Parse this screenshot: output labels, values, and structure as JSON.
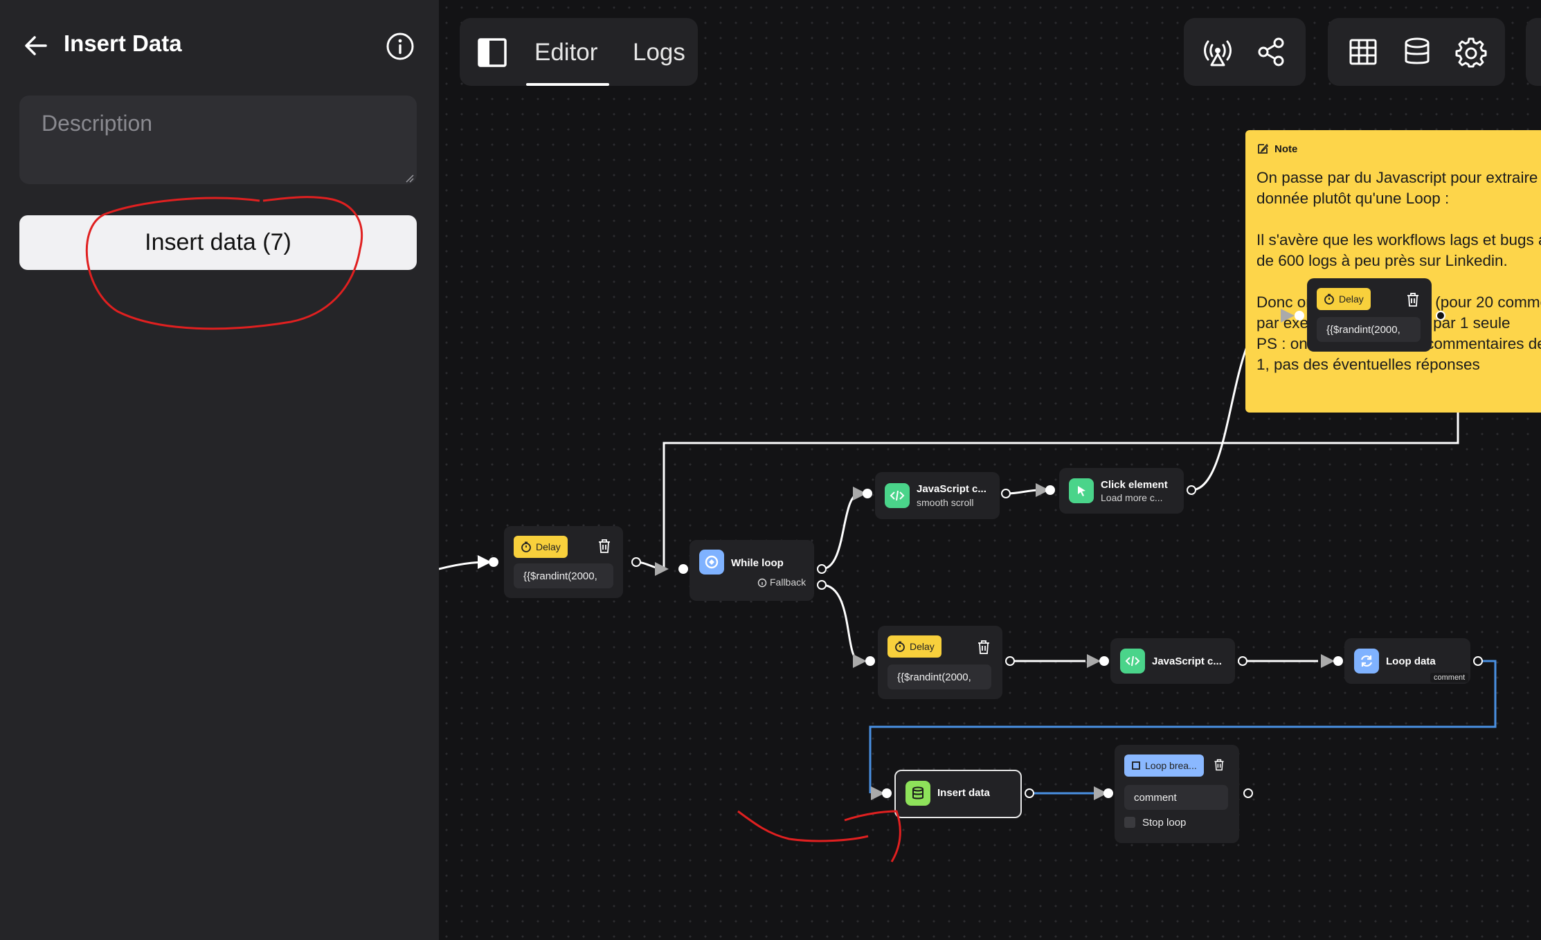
{
  "sidebar": {
    "title": "Insert Data",
    "description_placeholder": "Description",
    "insert_button_label": "Insert data (7)"
  },
  "toolbar": {
    "tabs": [
      {
        "label": "Editor",
        "active": true
      },
      {
        "label": "Logs",
        "active": false
      }
    ],
    "icons": [
      "sidebar-toggle-icon",
      "broadcast-icon",
      "share-icon",
      "table-icon",
      "database-icon",
      "settings-gear-icon"
    ]
  },
  "note": {
    "header": "Note",
    "text": "On passe par du Javascript pour extraire la donnée plutôt qu'une Loop :\n\nIl s'avère que les workflows lags et bugs au bout de 600 logs à peu près sur Linkedin.\n\nDonc on remplace 20 × 8 (pour 20 commentaires par exemple)  opérations par 1 seule\nPS : on se contente des commentaires de niveau 1, pas des éventuelles réponses"
  },
  "nodes": {
    "delay_left": {
      "badge": "Delay",
      "value": "{{$randint(2000,"
    },
    "while_loop": {
      "title": "While loop",
      "fallback": "Fallback"
    },
    "js_scroll": {
      "title": "JavaScript c...",
      "subtitle": "smooth scroll"
    },
    "click_element": {
      "title": "Click element",
      "subtitle": "Load more c..."
    },
    "delay_top": {
      "badge": "Delay",
      "value": "{{$randint(2000,"
    },
    "delay_bottom": {
      "badge": "Delay",
      "value": "{{$randint(2000,"
    },
    "js_bottom": {
      "title": "JavaScript c..."
    },
    "loop_data": {
      "title": "Loop data",
      "tag": "comment"
    },
    "insert_data": {
      "title": "Insert data"
    },
    "loop_break": {
      "badge": "Loop brea...",
      "field": "comment",
      "checkbox_label": "Stop loop"
    }
  },
  "colors": {
    "delay_badge": "#f8d03c",
    "while_icon": "#7fb2ff",
    "js_icon": "#4ad48a",
    "click_icon": "#4ad48a",
    "loop_icon": "#7fb2ff",
    "insert_icon": "#8ee25a",
    "loop_break_badge": "#8ab8ff",
    "note_bg": "#fdd54a",
    "blue_wire": "#4a90e2",
    "annotation_red": "#e02020"
  }
}
